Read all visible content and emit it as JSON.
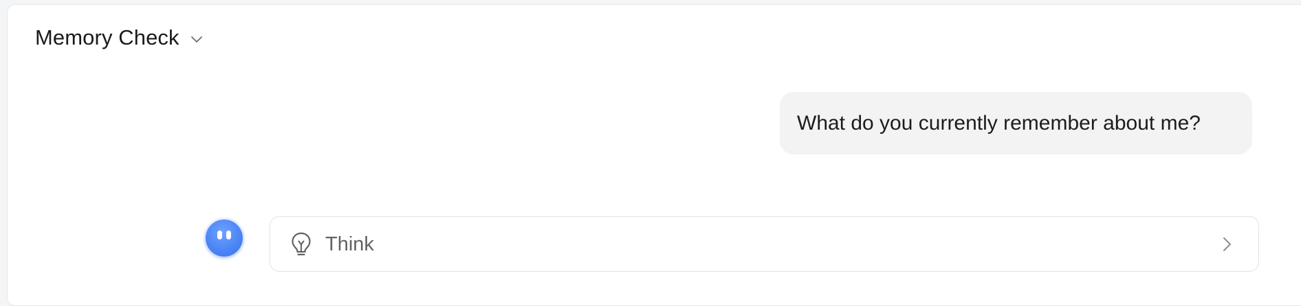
{
  "conversation": {
    "title": "Memory Check",
    "title_icon": "chevron-down-icon"
  },
  "messages": [
    {
      "role": "user",
      "text": "What do you currently remember about me?"
    }
  ],
  "assistant": {
    "avatar_icon": "assistant-avatar-icon",
    "think_panel": {
      "label": "Think",
      "icon": "lightbulb-icon",
      "expand_icon": "chevron-right-icon"
    }
  },
  "colors": {
    "background": "#f4f5f6",
    "panel": "#ffffff",
    "user_bubble": "#f3f3f4",
    "avatar": "#4c86f5",
    "think_border": "#e1e2e5",
    "muted_text": "#616366"
  }
}
